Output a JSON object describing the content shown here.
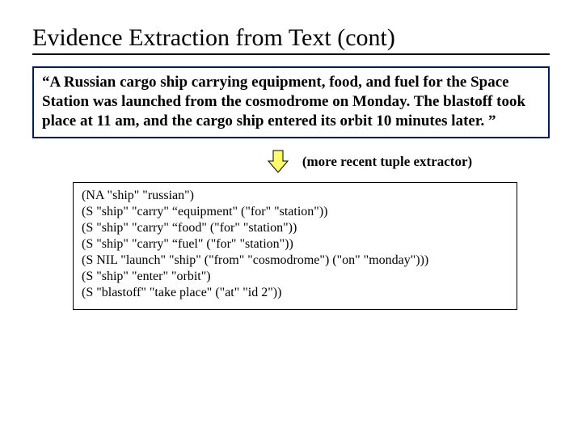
{
  "title": "Evidence Extraction from Text (cont)",
  "quote": "“A Russian cargo ship carrying equipment, food, and fuel for the Space Station was launched from the cosmodrome on Monday. The blastoff took place at 11 am, and the cargo ship entered its orbit 10 minutes later. ”",
  "arrow_label": "(more recent tuple extractor)",
  "tuples": {
    "l0": "(NA \"ship\" \"russian\")",
    "l1": "(S \"ship\" \"carry\" “equipment\" (\"for\" \"station\"))",
    "l2": "(S \"ship\" \"carry\" “food\" (\"for\" \"station\"))",
    "l3": "(S \"ship\" \"carry\" “fuel\" (\"for\" \"station\"))",
    "l4": "(S NIL \"launch\" \"ship\" (\"from\" \"cosmodrome\") (\"on\" \"monday\")))",
    "l5": "(S \"ship\" \"enter\" \"orbit\")",
    "l6": "(S \"blastoff\" \"take place\" (\"at\" \"id 2\"))"
  }
}
